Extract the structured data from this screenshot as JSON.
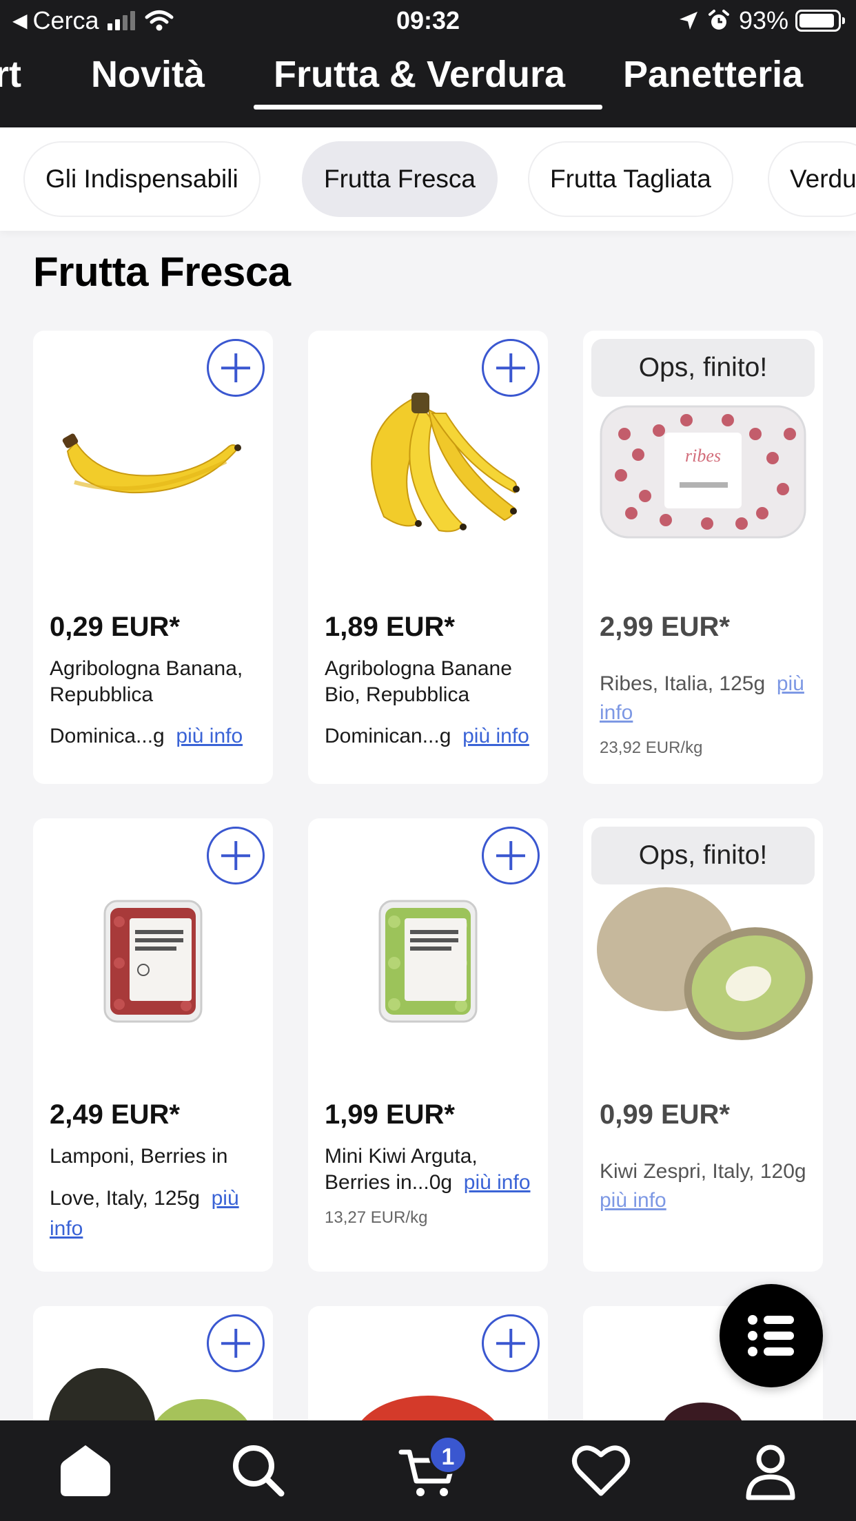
{
  "status_bar": {
    "back_label": "Cerca",
    "time": "09:32",
    "battery": "93%",
    "battery_level": 0.93
  },
  "category_tabs": [
    {
      "label": "rt"
    },
    {
      "label": "Novità"
    },
    {
      "label": "Frutta & Verdura",
      "active": true
    },
    {
      "label": "Panetteria"
    }
  ],
  "subcategories": [
    {
      "label": "Gli Indispensabili"
    },
    {
      "label": "Frutta Fresca",
      "active": true
    },
    {
      "label": "Frutta Tagliata"
    },
    {
      "label": "Verdu"
    }
  ],
  "section_title": "Frutta Fresca",
  "add_icon": "plus-circle-icon",
  "products": [
    {
      "price": "0,29 EUR*",
      "name": "Agribologna Banana, Repubblica",
      "name2": "Dominica...g",
      "more": "più info",
      "unit_price": "",
      "sold_out": false,
      "image": "single-banana"
    },
    {
      "price": "1,89 EUR*",
      "name": "Agribologna Banane Bio, Repubblica",
      "name2": "Dominican...g",
      "more": "più info",
      "unit_price": "",
      "sold_out": false,
      "image": "banana-bunch"
    },
    {
      "price": "2,99 EUR*",
      "name": "Ribes, Italia, 125g",
      "more": "più info",
      "unit_price": "23,92 EUR/kg",
      "sold_out": true,
      "badge": "Ops, finito!",
      "image": "redcurrant-pack"
    },
    {
      "price": "2,49 EUR*",
      "name": "Lamponi, Berries in",
      "name2": "Love, Italy, 125g",
      "more": "più info",
      "unit_price": "",
      "sold_out": false,
      "image": "raspberry-pack"
    },
    {
      "price": "1,99 EUR*",
      "name": "Mini Kiwi Arguta,",
      "name2": "Berries in...0g",
      "more": "più info",
      "unit_price": "13,27 EUR/kg",
      "sold_out": false,
      "image": "mini-kiwi-pack"
    },
    {
      "price": "0,99 EUR*",
      "name": "Kiwi Zespri, Italy, 120g",
      "more": "più info",
      "unit_price": "",
      "sold_out": true,
      "badge": "Ops, finito!",
      "image": "kiwi"
    }
  ],
  "cart_count": "1",
  "bottom_nav": [
    {
      "icon": "home-icon"
    },
    {
      "icon": "search-icon"
    },
    {
      "icon": "cart-icon"
    },
    {
      "icon": "heart-icon"
    },
    {
      "icon": "profile-icon"
    }
  ],
  "fab_icon": "list-icon",
  "colors": {
    "accent": "#3a57d0",
    "header_bg": "#1b1b1d",
    "link": "#3a63d6"
  }
}
